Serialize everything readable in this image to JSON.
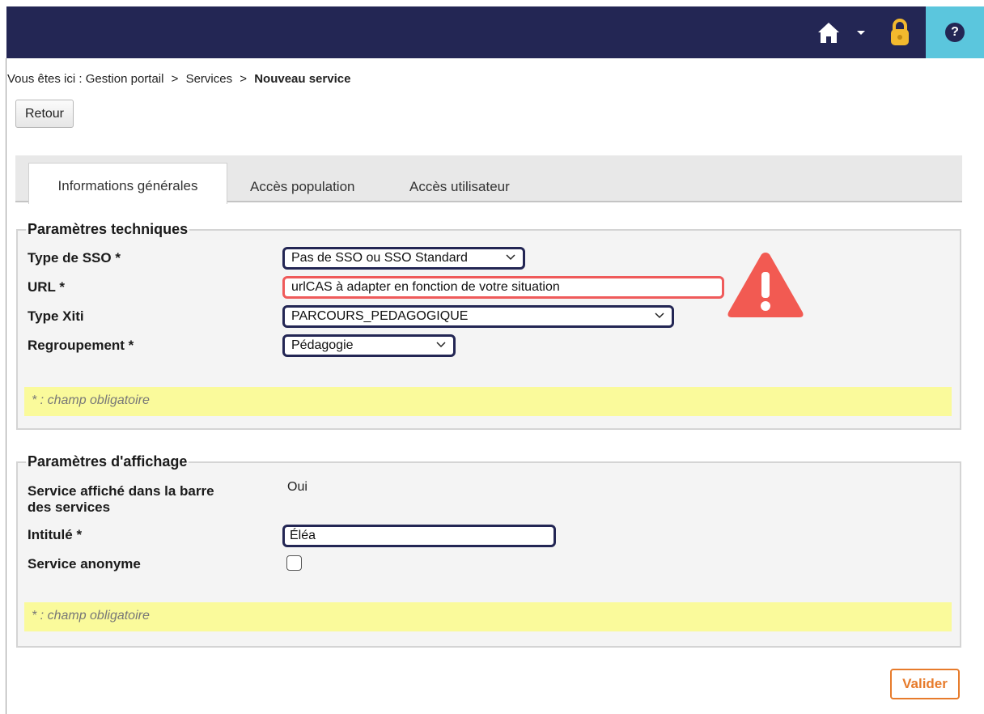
{
  "header": {
    "home_icon": "home-icon",
    "dropdown_icon": "caret-down-icon",
    "lock_icon": "padlock-icon",
    "help_label": "?",
    "bar_color": "#232654",
    "help_bg": "#5bc6dd"
  },
  "breadcrumb": {
    "prefix": "Vous êtes ici :",
    "items": [
      "Gestion portail",
      "Services"
    ],
    "separator": ">",
    "current": "Nouveau service"
  },
  "back_button": "Retour",
  "tabs": [
    "Informations générales",
    "Accès population",
    "Accès utilisateur"
  ],
  "technical": {
    "legend": "Paramètres techniques",
    "sso_label": "Type de SSO *",
    "sso_value": "Pas de SSO ou SSO Standard",
    "url_label": "URL *",
    "url_value": "urlCAS à adapter en fonction de votre situation",
    "xiti_label": "Type Xiti",
    "xiti_value": "PARCOURS_PEDAGOGIQUE",
    "group_label": "Regroupement *",
    "group_value": "Pédagogie",
    "warning_icon": "warning-triangle-icon",
    "note": "* : champ obligatoire"
  },
  "display": {
    "legend": "Paramètres d'affichage",
    "bar_label_line1": "Service affiché dans la barre",
    "bar_label_line2": "des services",
    "bar_value": "Oui",
    "title_label": "Intitulé *",
    "title_value": "Éléa",
    "anon_label": "Service anonyme",
    "anon_checked": false,
    "note": "* : champ obligatoire"
  },
  "submit_button": "Valider",
  "colors": {
    "accent_orange": "#e77b2b",
    "alert_red": "#ef5a5a",
    "note_yellow": "#fafa9b"
  }
}
